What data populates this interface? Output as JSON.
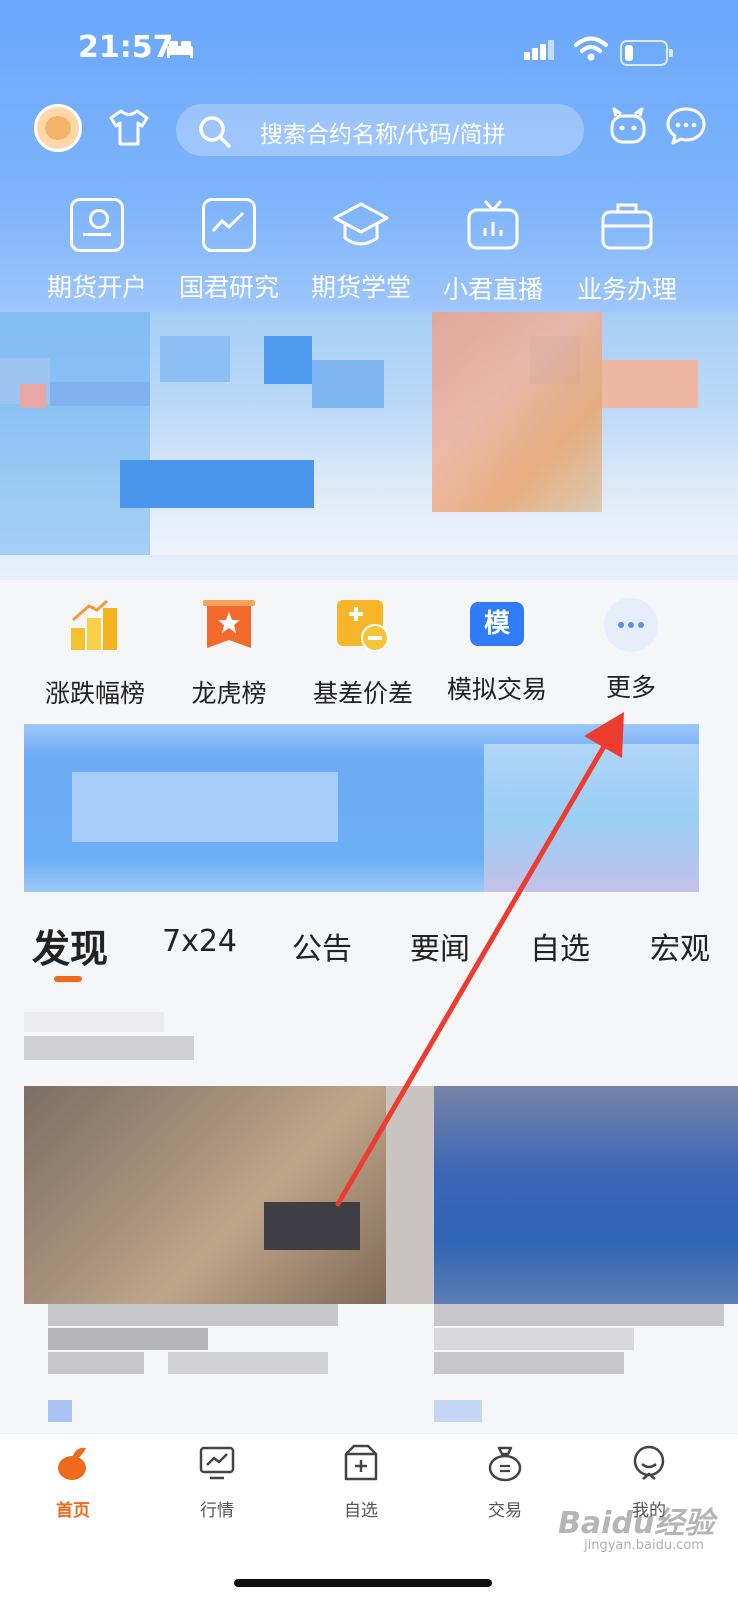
{
  "status_bar": {
    "time": "21:57"
  },
  "search": {
    "placeholder": "搜索合约名称/代码/简拼"
  },
  "quick_menu": [
    {
      "label": "期货开户",
      "icon": "account-card-icon"
    },
    {
      "label": "国君研究",
      "icon": "chart-monitor-icon"
    },
    {
      "label": "期货学堂",
      "icon": "graduation-cap-icon"
    },
    {
      "label": "小君直播",
      "icon": "tv-icon"
    },
    {
      "label": "业务办理",
      "icon": "briefcase-icon"
    }
  ],
  "tools": [
    {
      "label": "涨跌幅榜",
      "icon": "rank-bars-icon"
    },
    {
      "label": "龙虎榜",
      "icon": "star-ribbon-icon"
    },
    {
      "label": "基差价差",
      "icon": "plus-minus-icon"
    },
    {
      "label": "模拟交易",
      "icon": "mo-badge-icon",
      "badge": "模"
    },
    {
      "label": "更多",
      "icon": "more-dots-icon"
    }
  ],
  "feed_tabs": [
    "发现",
    "7x24",
    "公告",
    "要闻",
    "自选",
    "宏观"
  ],
  "active_feed_tab": "发现",
  "bottom_nav": [
    {
      "label": "首页",
      "icon": "home-icon",
      "active": true
    },
    {
      "label": "行情",
      "icon": "market-chart-icon",
      "active": false
    },
    {
      "label": "自选",
      "icon": "watchlist-box-icon",
      "active": false
    },
    {
      "label": "交易",
      "icon": "money-bag-icon",
      "active": false
    },
    {
      "label": "我的",
      "icon": "profile-face-icon",
      "active": false
    }
  ],
  "watermark": {
    "text": "Baidu经验",
    "sub": "jingyan.baidu.com"
  },
  "colors": {
    "accent": "#f06a1e",
    "header_blue": "#6aa7fb",
    "annotation_arrow": "#ee3b2f"
  }
}
